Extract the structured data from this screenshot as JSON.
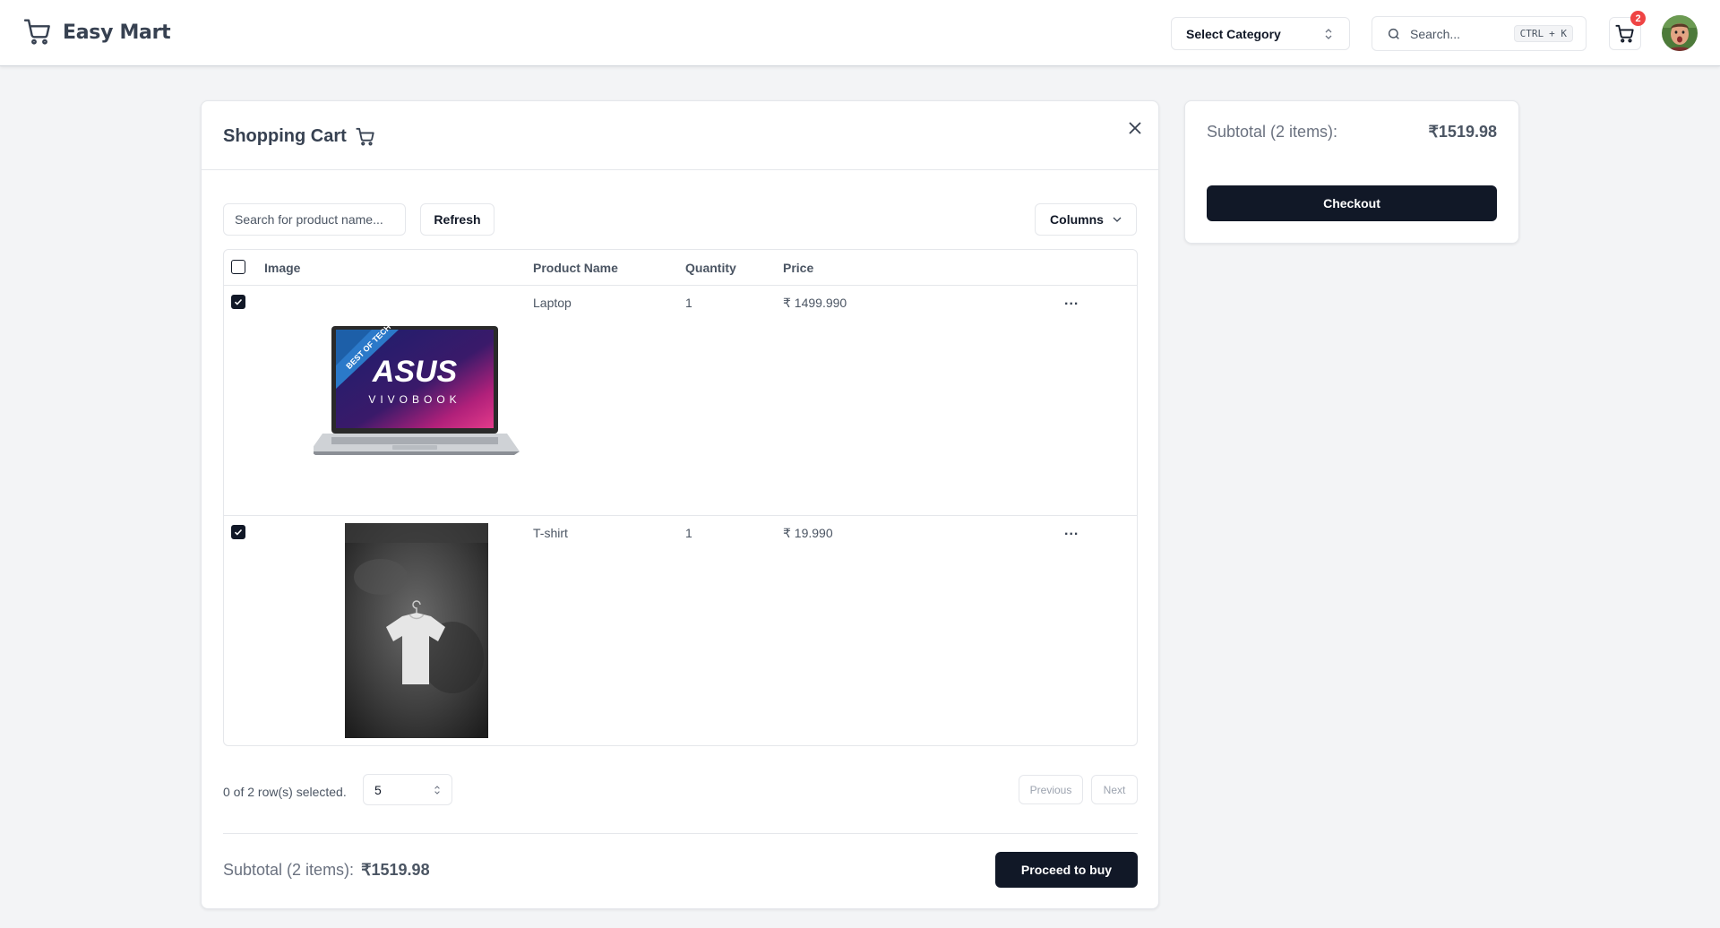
{
  "header": {
    "app_name": "Easy Mart",
    "category_select": "Select Category",
    "search_placeholder": "Search...",
    "shortcut_key1": "CTRL",
    "shortcut_key2": "+ K",
    "cart_count": "2"
  },
  "cart": {
    "title": "Shopping Cart",
    "filter_placeholder": "Search for product name...",
    "refresh_label": "Refresh",
    "columns_label": "Columns",
    "headers": {
      "image": "Image",
      "product_name": "Product Name",
      "quantity": "Quantity",
      "price": "Price"
    },
    "rows": [
      {
        "name": "Laptop",
        "quantity": "1",
        "price": "₹ 1499.990",
        "more": "...",
        "image_alt": "ASUS VIVOBOOK laptop",
        "image_text1": "ASUS",
        "image_text2": "VIVOBOOK",
        "image_text3": "BEST OF TECH"
      },
      {
        "name": "T-shirt",
        "quantity": "1",
        "price": "₹ 19.990",
        "more": "...",
        "image_alt": "white t-shirt on hanger"
      }
    ],
    "selection_text": "0 of 2 row(s) selected.",
    "page_size": "5",
    "previous_label": "Previous",
    "next_label": "Next",
    "subtotal_label": "Subtotal (2 items):",
    "subtotal_value": "₹1519.98",
    "proceed_label": "Proceed to buy"
  },
  "summary": {
    "subtotal_label": "Subtotal (2 items):",
    "subtotal_value": "₹1519.98",
    "checkout_label": "Checkout"
  },
  "colors": {
    "primary": "#111827",
    "badge": "#ef4444",
    "background": "#f3f4f6"
  }
}
